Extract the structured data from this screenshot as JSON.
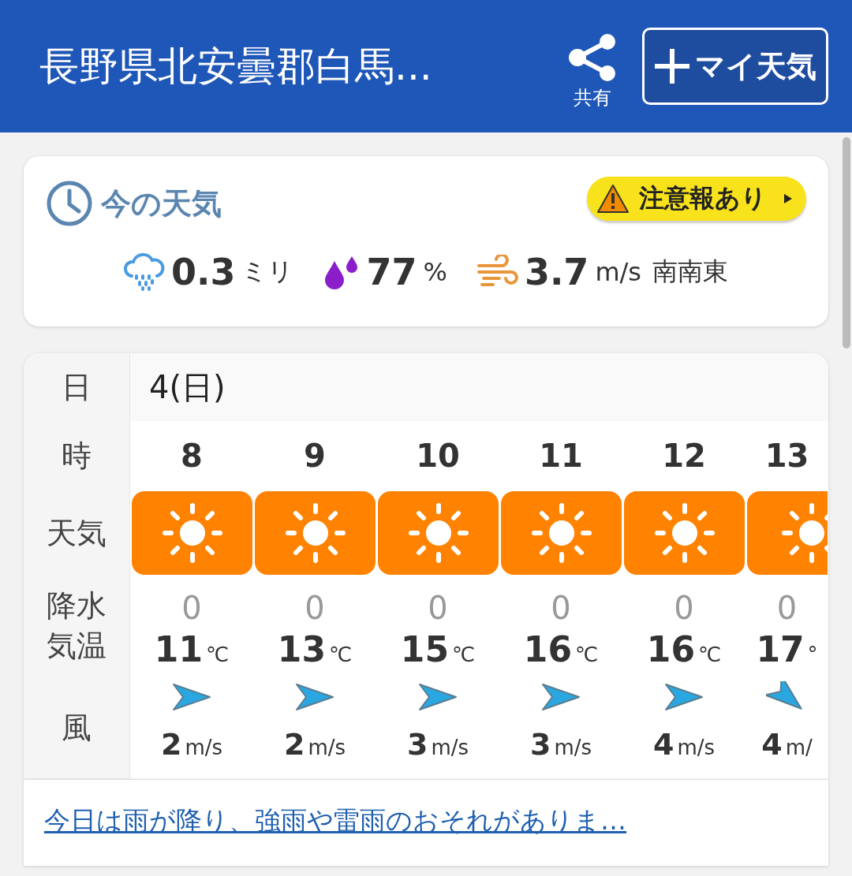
{
  "header": {
    "title": "長野県北安曇郡白馬...",
    "share_label": "共有",
    "my_weather_button": "マイ天気"
  },
  "current": {
    "title": "今の天気",
    "alert": "注意報あり",
    "precip": {
      "value": "0.3",
      "unit": "ミリ"
    },
    "humidity": {
      "value": "77",
      "unit": "%"
    },
    "wind": {
      "value": "3.7",
      "unit": "m/s",
      "direction": "南南東"
    }
  },
  "forecast": {
    "labels": {
      "date": "日",
      "hour": "時",
      "weather": "天気",
      "precip": "降水",
      "temp": "気温",
      "wind": "風"
    },
    "date": "4(日)",
    "hours": [
      {
        "hour": "8",
        "weather": {
          "kind": "sunny"
        },
        "precip": "0",
        "temp": "11",
        "temp_unit": "℃",
        "wind_arrow": {
          "kind": "west"
        },
        "wind_speed": "2",
        "wind_unit": "m/s"
      },
      {
        "hour": "9",
        "weather": {
          "kind": "sunny"
        },
        "precip": "0",
        "temp": "13",
        "temp_unit": "℃",
        "wind_arrow": {
          "kind": "west"
        },
        "wind_speed": "2",
        "wind_unit": "m/s"
      },
      {
        "hour": "10",
        "weather": {
          "kind": "sunny"
        },
        "precip": "0",
        "temp": "15",
        "temp_unit": "℃",
        "wind_arrow": {
          "kind": "west"
        },
        "wind_speed": "3",
        "wind_unit": "m/s"
      },
      {
        "hour": "11",
        "weather": {
          "kind": "sunny"
        },
        "precip": "0",
        "temp": "16",
        "temp_unit": "℃",
        "wind_arrow": {
          "kind": "west"
        },
        "wind_speed": "3",
        "wind_unit": "m/s"
      },
      {
        "hour": "12",
        "weather": {
          "kind": "sunny"
        },
        "precip": "0",
        "temp": "16",
        "temp_unit": "℃",
        "wind_arrow": {
          "kind": "west"
        },
        "wind_speed": "4",
        "wind_unit": "m/s"
      },
      {
        "hour": "13",
        "weather": {
          "kind": "sunny"
        },
        "precip": "0",
        "temp": "17",
        "temp_unit": "°",
        "wind_arrow": {
          "kind": "northwest"
        },
        "wind_speed": "4",
        "wind_unit": "m/"
      }
    ]
  },
  "summary_link": "今日は雨が降り、強雨や雷雨のおそれがありま…"
}
